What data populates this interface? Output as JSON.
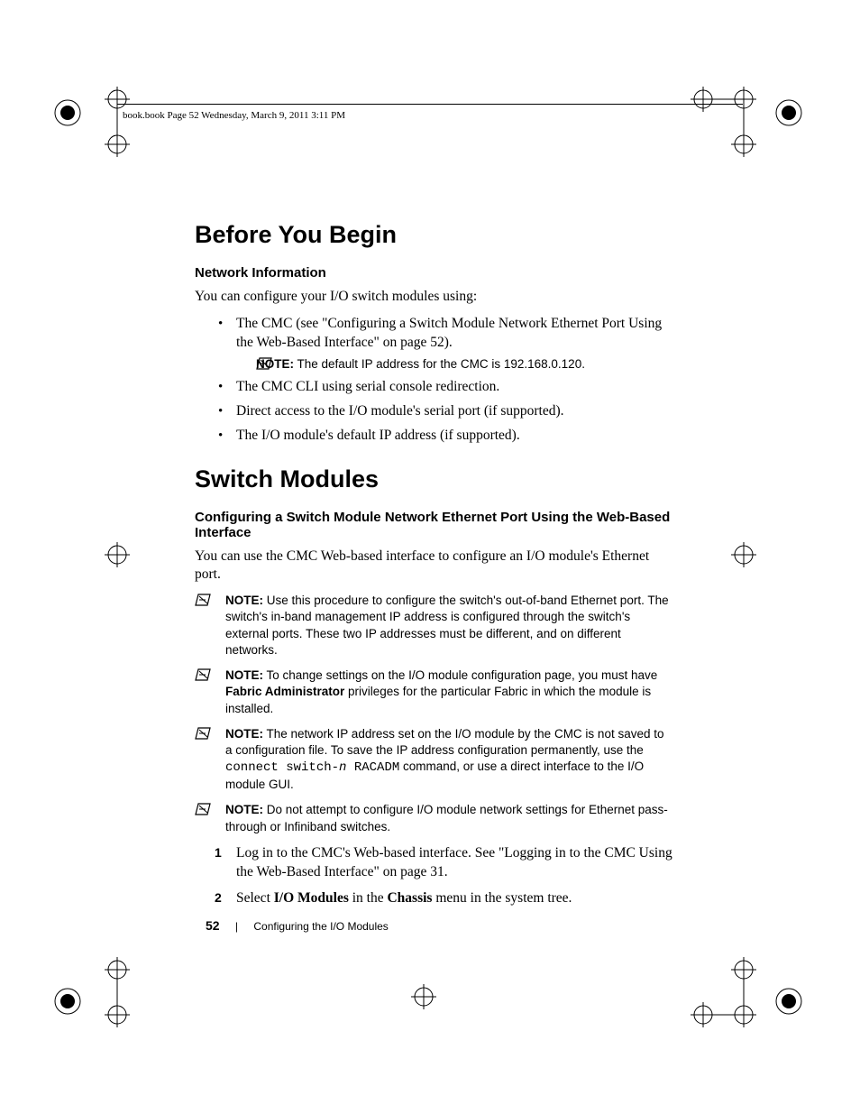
{
  "header": "book.book  Page 52  Wednesday, March 9, 2011  3:11 PM",
  "h1a": "Before You Begin",
  "h2a": "Network Information",
  "p1": "You can configure your I/O switch modules using:",
  "bullets": [
    "The CMC (see \"Configuring a Switch Module Network Ethernet Port Using the Web-Based Interface\" on page 52).",
    "The CMC CLI using serial console redirection.",
    "Direct access to the I/O module's serial port (if supported).",
    "The I/O module's default IP address (if supported)."
  ],
  "note_inline": "The default IP address for the CMC is 192.168.0.120.",
  "h1b": "Switch Modules",
  "h2b": "Configuring a Switch Module Network Ethernet Port Using the Web-Based Interface",
  "p2": "You can use the CMC Web-based interface to configure an I/O module's Ethernet port.",
  "note_label": "NOTE:",
  "notes": [
    "Use this procedure to configure the switch's out-of-band Ethernet port. The switch's in-band management IP address is configured through the switch's external ports. These two IP addresses must be different, and on different networks.",
    "",
    "",
    "Do not attempt to configure I/O module network settings for Ethernet pass-through or Infiniband switches."
  ],
  "note2_pre": "To change settings on the I/O module configuration page, you must have ",
  "note2_bold": "Fabric Administrator",
  "note2_post": " privileges for the particular Fabric in which the module is installed.",
  "note3_pre": "The network IP address set on the I/O module by the CMC is not saved to a configuration file. To save the IP address configuration permanently, use the ",
  "note3_cmd1": "connect switch-",
  "note3_cmd2": "n",
  "note3_cmd3": " RACADM",
  "note3_post": " command, or use a direct interface to the I/O module GUI.",
  "step1_pre": "Log in to the CMC's Web-based interface. See \"Logging in to the CMC Using the Web-Based Interface\" on page 31.",
  "step2_pre": "Select ",
  "step2_b1": "I/O Modules",
  "step2_mid": " in the ",
  "step2_b2": "Chassis",
  "step2_post": " menu in the system tree.",
  "footer_page": "52",
  "footer_text": "Configuring the I/O Modules"
}
